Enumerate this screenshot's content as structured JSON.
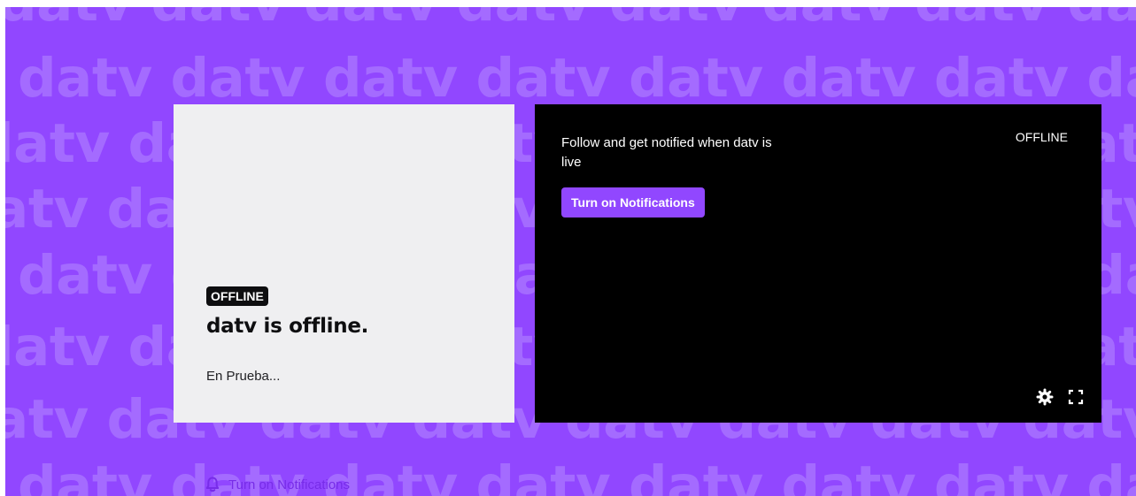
{
  "watermark": {
    "text": "datv datv datv datv datv datv datv datv datv"
  },
  "offline_card": {
    "badge": "OFFLINE",
    "title": "datv is offline.",
    "description": "En Prueba...",
    "notify_label": "Turn on Notifications"
  },
  "player": {
    "message": "Follow and get notified when datv is live",
    "button_label": "Turn on Notifications",
    "status": "OFFLINE",
    "settings_icon": "gear-icon",
    "fullscreen_icon": "fullscreen-icon"
  },
  "colors": {
    "brand_purple": "#9147ff",
    "watermark_purple": "#a46bff",
    "link_purple": "#772ce8",
    "card_bg": "#efeff1",
    "player_bg": "#000000"
  }
}
